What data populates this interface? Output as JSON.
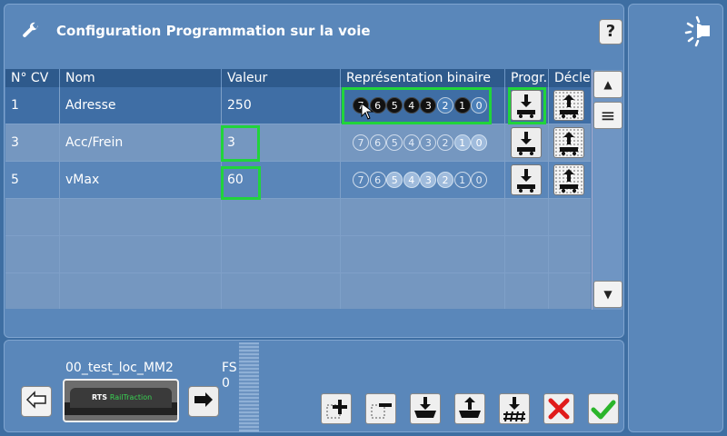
{
  "header": {
    "title": "Configuration Programmation sur la voie",
    "help_label": "?"
  },
  "table": {
    "columns": [
      "N° CV",
      "Nom",
      "Valeur",
      "Représentation binaire",
      "Progr.",
      "Décle"
    ],
    "rows": [
      {
        "cv": "1",
        "name": "Adresse",
        "value": "250",
        "bits": [
          "7",
          "6",
          "5",
          "4",
          "3",
          "2",
          "1",
          "0"
        ]
      },
      {
        "cv": "3",
        "name": "Acc/Frein",
        "value": "3",
        "bits": [
          "7",
          "6",
          "5",
          "4",
          "3",
          "2",
          "1",
          "0"
        ]
      },
      {
        "cv": "5",
        "name": "vMax",
        "value": "60",
        "bits": [
          "7",
          "6",
          "5",
          "4",
          "3",
          "2",
          "1",
          "0"
        ]
      }
    ]
  },
  "locomotive": {
    "name": "00_test_loc_MM2",
    "fs_label": "FS",
    "fs_value": "0",
    "image_text_main": "RTS",
    "image_text_sub": "RailTraction"
  },
  "colors": {
    "highlight": "#21d43b",
    "panel": "#5a87ba",
    "background": "#3e6ea2",
    "header_row": "#2e5a8c"
  }
}
